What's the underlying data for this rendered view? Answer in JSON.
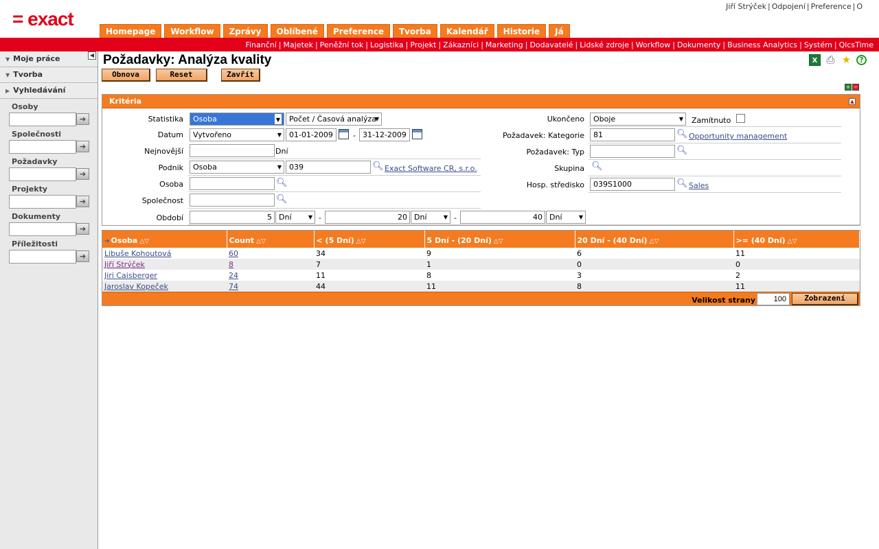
{
  "header": {
    "logo_text": "= exact",
    "user_links": [
      "Jiří Strýček",
      "Odpojení",
      "Preference",
      "O"
    ]
  },
  "main_tabs": [
    "Homepage",
    "Workflow",
    "Zprávy",
    "Oblíbené",
    "Preference",
    "Tvorba",
    "Kalendář",
    "Historie",
    "Já"
  ],
  "module_links": [
    "Finanční",
    "Majetek",
    "Peněžní tok",
    "Logistika",
    "Projekt",
    "Zákazníci",
    "Marketing",
    "Dodavatelé",
    "Lidské zdroje",
    "Workflow",
    "Dokumenty",
    "Business Analytics",
    "Systém",
    "QicsTime"
  ],
  "sidebar": {
    "sections": [
      "Moje práce",
      "Tvorba",
      "Vyhledávání"
    ],
    "search_fields": [
      "Osoby",
      "Společnosti",
      "Požadavky",
      "Projekty",
      "Dokumenty",
      "Příležitosti"
    ]
  },
  "page": {
    "title": "Požadavky: Analýza kvality",
    "buttons": {
      "refresh": "Obnova",
      "reset": "Reset",
      "close": "Zavřít"
    }
  },
  "criteria": {
    "title": "Kritéria",
    "statistika_label": "Statistika",
    "statistika_value": "Osoba",
    "analysis_value": "Počet / Časová analýza",
    "datum_label": "Datum",
    "datum_type": "Vytvořeno",
    "date_from": "01-01-2009",
    "date_to": "31-12-2009",
    "date_sep": "-",
    "nejnovejsi_label": "Nejnovější",
    "nejnovejsi_value": "",
    "days_unit": "Dní",
    "podnik_label": "Podnik",
    "podnik_type": "Osoba",
    "podnik_value": "039",
    "podnik_link": "Exact Software CR, s.r.o.",
    "osoba_label": "Osoba",
    "osoba_value": "",
    "spolecnost_label": "Společnost",
    "spolecnost_value": "",
    "obdobi_label": "Období",
    "period1": "5",
    "period1_unit": "Dní",
    "period2": "20",
    "period2_unit": "Dní",
    "period3": "40",
    "period3_unit": "Dní",
    "ukonceno_label": "Ukončeno",
    "ukonceno_value": "Oboje",
    "zamitnuto_label": "Zamítnuto",
    "kategorie_label": "Požadavek: Kategorie",
    "kategorie_value": "81",
    "kategorie_link": "Opportunity management",
    "typ_label": "Požadavek: Typ",
    "typ_value": "",
    "skupina_label": "Skupina",
    "stredisko_label": "Hosp. středisko",
    "stredisko_value": "039S1000",
    "stredisko_link": "Sales"
  },
  "results": {
    "columns": [
      "Osoba",
      "Count",
      "< (5 Dní)",
      "5 Dní - (20 Dní)",
      "20 Dní - (40 Dní)",
      ">= (40 Dní)"
    ],
    "rows": [
      [
        "Libuše Kohoutová",
        "60",
        "34",
        "9",
        "6",
        "11"
      ],
      [
        "Jiří Strýček",
        "8",
        "7",
        "1",
        "0",
        "0"
      ],
      [
        "Jiri Caisberger",
        "24",
        "11",
        "8",
        "3",
        "2"
      ],
      [
        "Jaroslav Kopeček",
        "74",
        "44",
        "11",
        "8",
        "11"
      ]
    ],
    "page_size_label": "Velikost strany",
    "page_size_value": "100",
    "show_button": "Zobrazení"
  }
}
